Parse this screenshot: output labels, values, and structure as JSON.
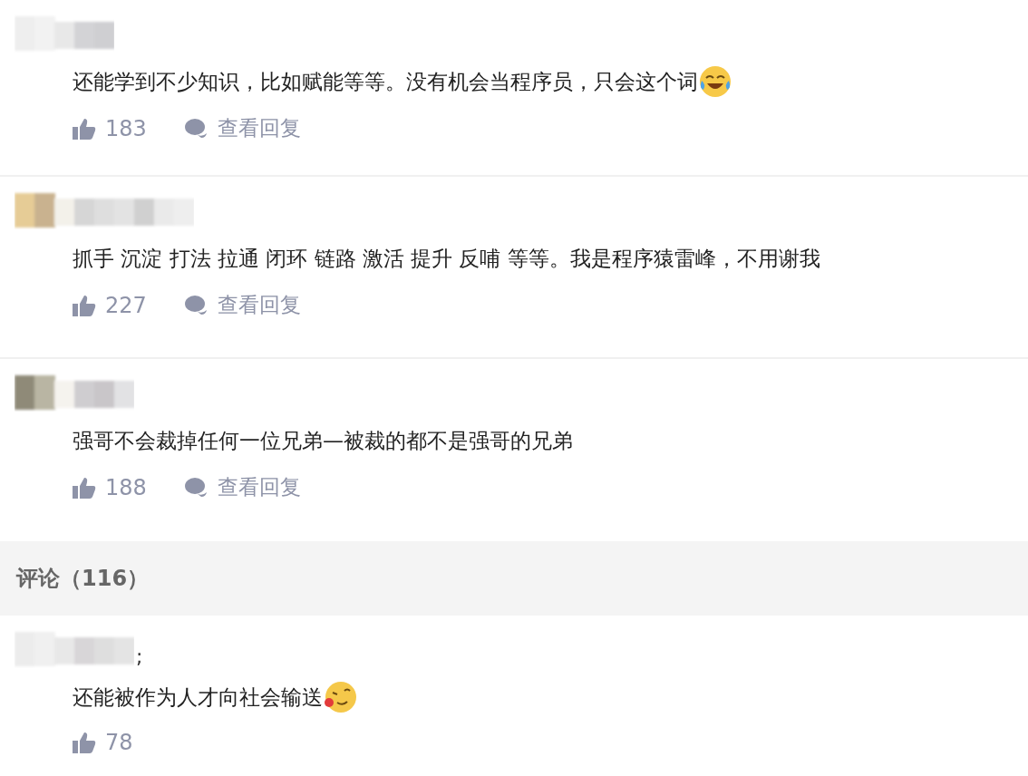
{
  "comments": [
    {
      "text": "还能学到不少知识，比如赋能等等。没有机会当程序员，只会这个词",
      "emoji": {
        "kind": "laugh-cry"
      },
      "likes": "183",
      "view_replies": "查看回复"
    },
    {
      "text": "抓手 沉淀 打法 拉通 闭环 链路 激活 提升 反哺 等等。我是程序猿雷峰，不用谢我",
      "likes": "227",
      "view_replies": "查看回复"
    },
    {
      "text": "强哥不会裁掉任何一位兄弟—被裁的都不是强哥的兄弟",
      "likes": "188",
      "view_replies": "查看回复"
    }
  ],
  "section_header": {
    "label": "评论（116）"
  },
  "comments_more": [
    {
      "name_suffix": ";",
      "text": "还能被作为人才向社会输送",
      "emoji": {
        "kind": "tongue"
      },
      "likes": "78"
    }
  ]
}
